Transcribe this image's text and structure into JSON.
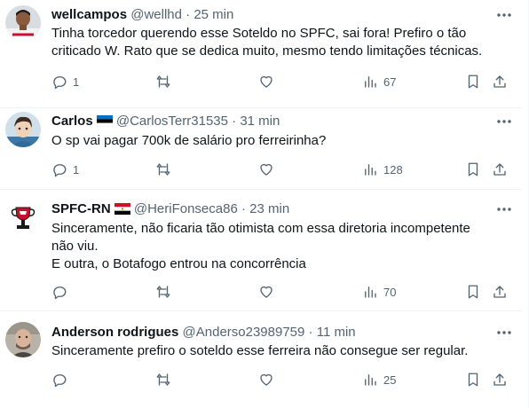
{
  "tweets": [
    {
      "name": "wellcampos",
      "handle": "@wellhd",
      "time": "25 min",
      "lines": [
        "Tinha torcedor querendo esse Soteldo no SPFC, sai fora! Prefiro o tão",
        "criticado W. Rato que se dedica muito, mesmo tendo limitações técnicas."
      ],
      "replies": "1",
      "views": "67",
      "flag": ""
    },
    {
      "name": "Carlos",
      "handle": "@CarlosTerr31535",
      "time": "31 min",
      "lines": [
        "O sp vai pagar 700k de salário pro ferreirinha?"
      ],
      "replies": "1",
      "views": "128",
      "flag": "estonia-flag"
    },
    {
      "name": "SPFC-RN",
      "handle": "@HeriFonseca86",
      "time": "23 min",
      "lines": [
        "Sinceramente, não ficaria tão otimista com essa diretoria incompetente",
        "não viu.",
        "E outra, o Botafogo entrou na concorrência"
      ],
      "replies": "",
      "views": "70",
      "flag": "egypt-flag"
    },
    {
      "name": "Anderson rodrigues",
      "handle": "@Anderso23989759",
      "time": "11 min",
      "lines": [
        "Sinceramente prefiro o soteldo esse ferreira não consegue ser regular."
      ],
      "replies": "",
      "views": "25",
      "flag": ""
    }
  ],
  "separator": "·",
  "colors": {
    "text": "#0f1419",
    "muted": "#536471",
    "border": "#eff3f4"
  },
  "icons": [
    "reply-icon",
    "retweet-icon",
    "like-icon",
    "views-icon",
    "bookmark-icon",
    "share-icon",
    "more-icon"
  ]
}
